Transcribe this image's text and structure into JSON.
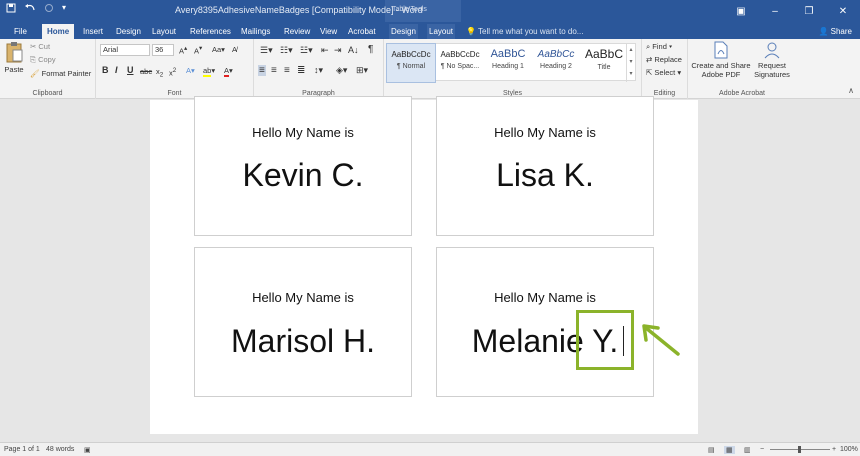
{
  "titlebar": {
    "doc_title": "Avery8395AdhesiveNameBadges [Compatibility Mode] - Word",
    "context_title": "Table Tools",
    "qat_save": "save-icon",
    "qat_undo": "undo-icon",
    "qat_redo": "redo-icon"
  },
  "tabs": [
    "File",
    "Home",
    "Insert",
    "Design",
    "Layout",
    "References",
    "Mailings",
    "Review",
    "View",
    "Acrobat",
    "Design",
    "Layout"
  ],
  "tell_me": "Tell me what you want to do...",
  "share": "Share",
  "ribbon": {
    "clipboard": {
      "paste": "Paste",
      "cut": "Cut",
      "copy": "Copy",
      "format_painter": "Format Painter",
      "label": "Clipboard"
    },
    "font": {
      "name": "Arial",
      "size": "36",
      "label": "Font"
    },
    "paragraph": {
      "label": "Paragraph"
    },
    "styles": {
      "label": "Styles",
      "items": [
        {
          "sample": "AaBbCcDc",
          "name": "¶ Normal"
        },
        {
          "sample": "AaBbCcDc",
          "name": "¶ No Spac..."
        },
        {
          "sample": "AaBbC",
          "name": "Heading 1"
        },
        {
          "sample": "AaBbCc",
          "name": "Heading 2"
        },
        {
          "sample": "AaBbC",
          "name": "Title"
        }
      ]
    },
    "editing": {
      "find": "Find",
      "replace": "Replace",
      "select": "Select",
      "label": "Editing"
    },
    "acrobat": {
      "create_share": "Create and Share",
      "create_share2": "Adobe PDF",
      "request": "Request",
      "request2": "Signatures",
      "label": "Adobe Acrobat"
    }
  },
  "badges": [
    {
      "hello": "Hello My Name is",
      "name": "Kevin C."
    },
    {
      "hello": "Hello My Name is",
      "name": "Lisa K."
    },
    {
      "hello": "Hello My Name is",
      "name": "Marisol H."
    },
    {
      "hello": "Hello My Name is",
      "name": "Melanie Y."
    }
  ],
  "status": {
    "page": "Page 1 of 1",
    "words": "48 words",
    "zoom": "100%"
  },
  "colors": {
    "accent": "#2b579a",
    "highlight": "#8bb32a"
  }
}
